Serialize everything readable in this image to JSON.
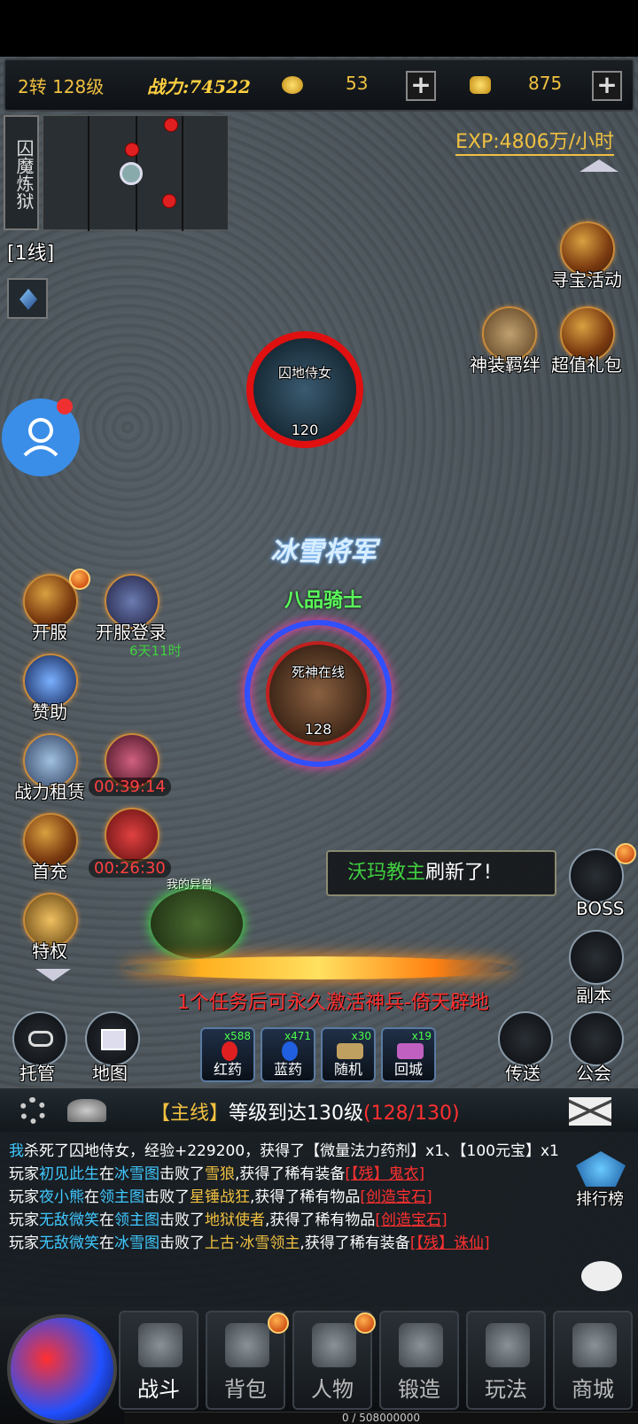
{
  "hud": {
    "level": "2转 128级",
    "power": "战力:74522",
    "currency1": "53",
    "currency2": "875",
    "plus": "+"
  },
  "map": {
    "zone_name": "囚魔炼狱",
    "line": "[1线]",
    "exp_rate": "EXP:4806万/小时"
  },
  "right_icons": {
    "treasure": "寻宝活动",
    "gear_bond": "神装羁绊",
    "value_pack": "超值礼包"
  },
  "enemy": {
    "name": "囚地侍女",
    "level": "120"
  },
  "player": {
    "title": "冰雪将军",
    "rank": "八品骑士",
    "name": "死神在线",
    "level": "128"
  },
  "left_icons": {
    "server_open": "开服",
    "server_login": "开服登录",
    "login_timer": "6天11时",
    "sponsor": "赞助",
    "power_rent": "战力租赁",
    "week_card_timer": "00:39:14",
    "first_charge": "首充",
    "gift_timer": "00:26:30",
    "privilege": "特权"
  },
  "pet_label": "我的异兽",
  "boss_notice": {
    "name": "沃玛教主",
    "text": "刷新了!"
  },
  "side_right": {
    "boss": "BOSS",
    "dungeon": "副本",
    "teleport": "传送",
    "guild": "公会"
  },
  "quest_weapon": {
    "prefix": "1个任务后可永久激活",
    "weapon": "神兵-倚天辟地"
  },
  "bottom_left": {
    "auto": "托管",
    "map": "地图"
  },
  "potions": [
    {
      "name": "红药",
      "count": "x588"
    },
    {
      "name": "蓝药",
      "count": "x471"
    },
    {
      "name": "随机",
      "count": "x30"
    },
    {
      "name": "回城",
      "count": "x19"
    }
  ],
  "quest": {
    "tag": "【主线】",
    "text": "等级到达130级",
    "progress": "(128/130)"
  },
  "ranking": "排行榜",
  "chat": {
    "me": "我",
    "kill_msg": "杀死了囚地侍女，经验+229200，获得了【微量法力药剂】x1、【100元宝】x1",
    "lines": [
      {
        "p": "玩家",
        "player": "初见此生",
        "in": "在",
        "map": "冰雪图",
        "act": "击败了",
        "mob": "雪狼",
        "got": ",获得了稀有装备",
        "item": "[【残】鬼衣]"
      },
      {
        "p": "玩家",
        "player": "夜小熊",
        "in": "在",
        "map": "领主图",
        "act": "击败了",
        "mob": "星锤战狂",
        "got": ",获得了稀有物品",
        "item": "[创造宝石]"
      },
      {
        "p": "玩家",
        "player": "无敌微笑",
        "in": "在",
        "map": "领主图",
        "act": "击败了",
        "mob": "地狱使者",
        "got": ",获得了稀有物品",
        "item": "[创造宝石]"
      },
      {
        "p": "玩家",
        "player": "无敌微笑",
        "in": "在",
        "map": "冰雪图",
        "act": "击败了",
        "mob": "上古·冰雪领主",
        "got": ",获得了稀有装备",
        "item": "[【残】诛仙]"
      }
    ]
  },
  "nav": [
    "战斗",
    "背包",
    "人物",
    "锻造",
    "玩法",
    "商城"
  ],
  "exp_bar": "0 / 508000000",
  "colors": {
    "gold": "#f0c040",
    "green": "#40d040",
    "red": "#ff3030",
    "cyan": "#40c8ff"
  }
}
